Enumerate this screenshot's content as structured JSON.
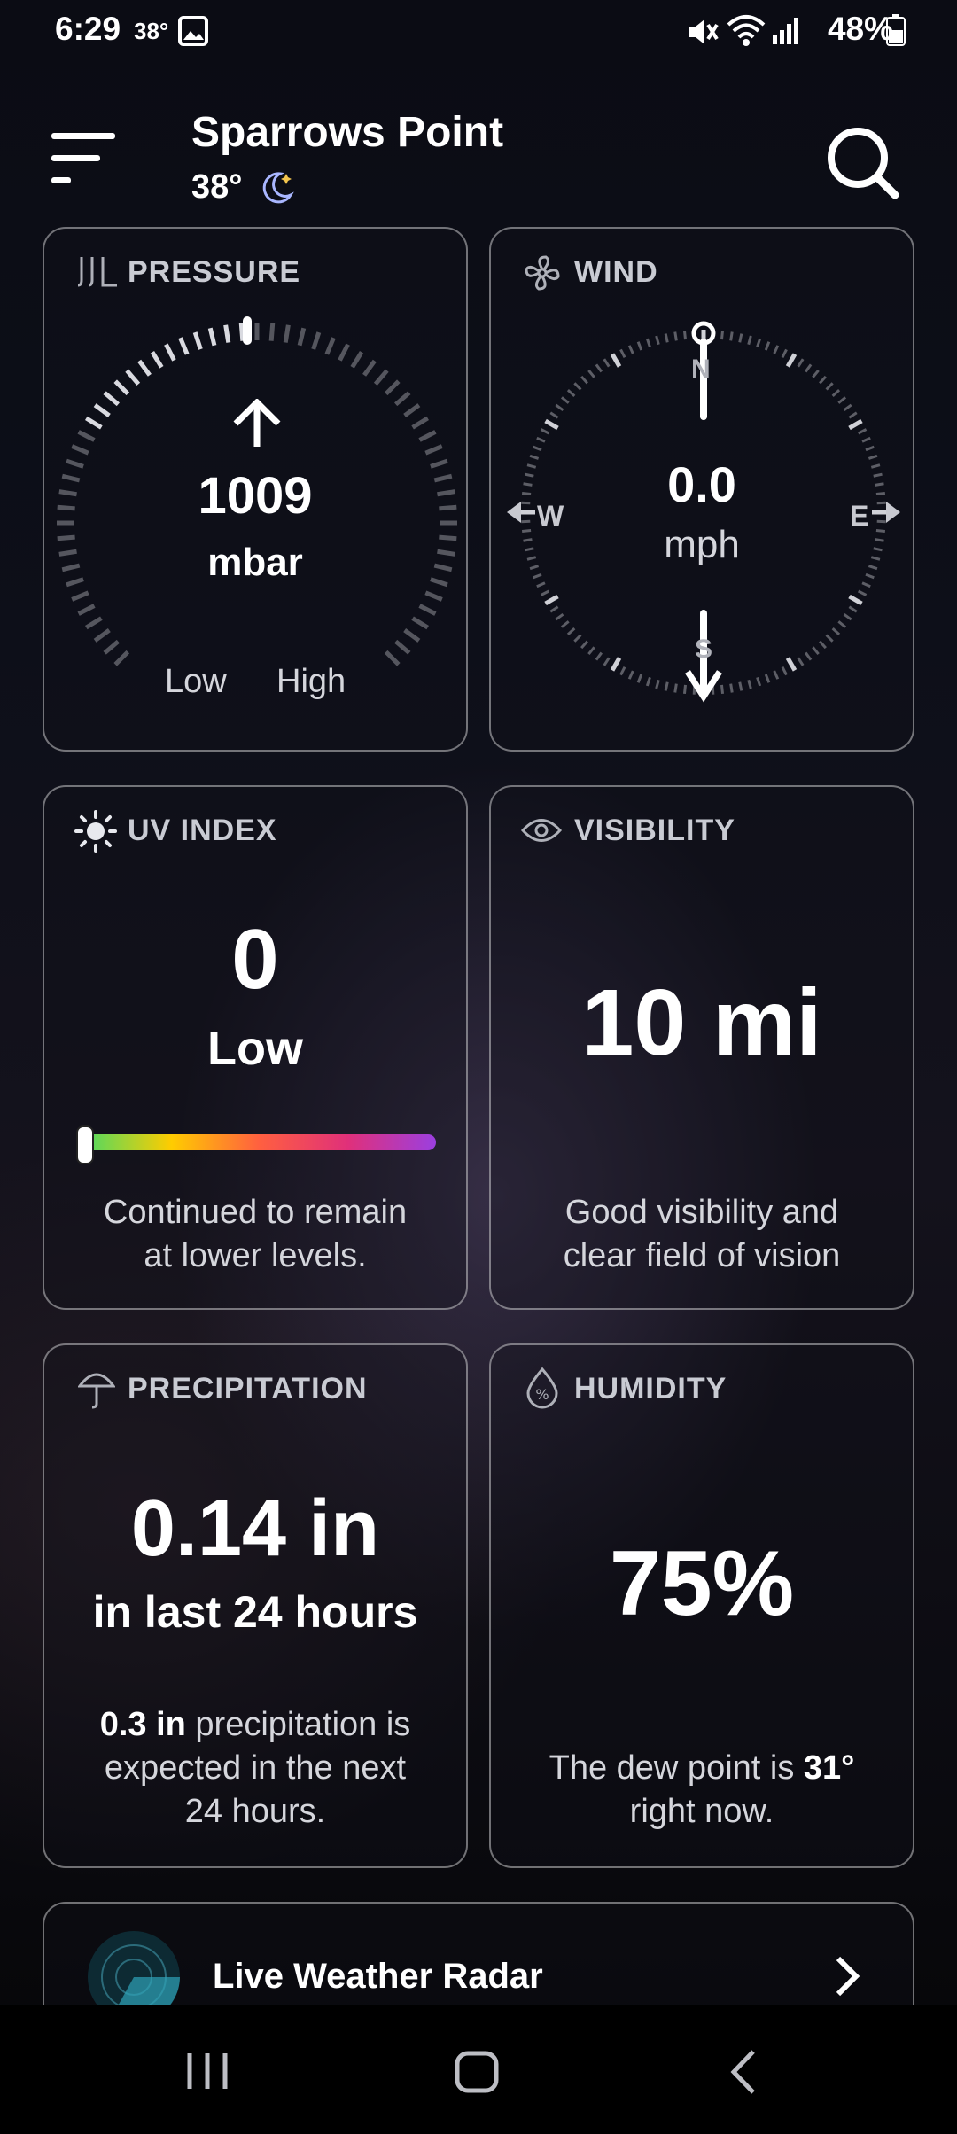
{
  "status_bar": {
    "time": "6:29",
    "temperature": "38°",
    "battery_percent": "48%",
    "icons": [
      "gallery-icon",
      "mute-icon",
      "wifi-icon",
      "signal-icon",
      "battery-icon"
    ]
  },
  "header": {
    "location": "Sparrows Point",
    "temperature": "38°",
    "condition_icon": "moon-stars-icon"
  },
  "pressure": {
    "title": "PRESSURE",
    "value": "1009",
    "unit": "mbar",
    "low_label": "Low",
    "high_label": "High",
    "trend_icon": "arrow-up-icon"
  },
  "wind": {
    "title": "WIND",
    "value": "0.0",
    "unit": "mph",
    "north": "N",
    "south": "S",
    "east": "E",
    "west": "W"
  },
  "uv": {
    "title": "UV INDEX",
    "value": "0",
    "level": "Low",
    "level_fraction": 0,
    "description_line1": "Continued to remain",
    "description_line2": "at lower levels."
  },
  "visibility": {
    "title": "VISIBILITY",
    "value": "10 mi",
    "description_line1": "Good visibility and",
    "description_line2": "clear field of vision"
  },
  "precipitation": {
    "title": "PRECIPITATION",
    "value": "0.14 in",
    "period": "in last 24 hours",
    "expected_amount": "0.3 in",
    "description_line1": "precipitation is",
    "description_line2": "expected in the next",
    "description_line3": "24 hours."
  },
  "humidity": {
    "title": "HUMIDITY",
    "value": "75%",
    "dew_text": "The dew point is",
    "dew_value": "31°",
    "dew_suffix": "right now."
  },
  "radar": {
    "label": "Live Weather Radar"
  },
  "colors": {
    "background": "#0b0c14",
    "card_border": "#8e8f96",
    "uv_gradient": [
      "#4cd964",
      "#ffcc00",
      "#ff5f40",
      "#e0307a",
      "#9b3fe0"
    ]
  }
}
